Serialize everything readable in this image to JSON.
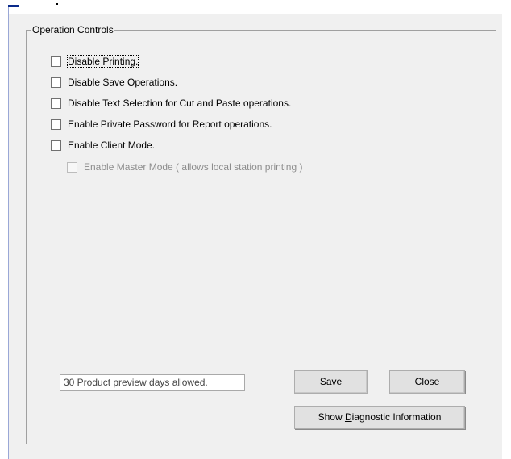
{
  "window": {
    "group_title": "Operation Controls"
  },
  "options": [
    {
      "label": "Disable Printing.",
      "checked": false,
      "enabled": true,
      "focused": true
    },
    {
      "label": "Disable Save Operations.",
      "checked": false,
      "enabled": true
    },
    {
      "label": "Disable Text Selection for Cut and Paste operations.",
      "checked": false,
      "enabled": true
    },
    {
      "label": "Enable Private Password for Report operations.",
      "checked": false,
      "enabled": true
    },
    {
      "label": "Enable Client Mode.",
      "checked": false,
      "enabled": true
    },
    {
      "label": "Enable Master Mode ( allows local station printing )",
      "checked": false,
      "enabled": false
    }
  ],
  "status": {
    "text": "30 Product preview days allowed."
  },
  "buttons": {
    "save": {
      "mnemonic": "S",
      "rest": "ave"
    },
    "close": {
      "mnemonic": "C",
      "rest": "lose"
    },
    "diagnostic": {
      "pre": "Show ",
      "mnemonic": "D",
      "rest": "iagnostic Information"
    }
  },
  "colors": {
    "panel_bg": "#f0f0f0",
    "disabled_text": "#8d8d8d",
    "accent": "#0a2a8a"
  }
}
